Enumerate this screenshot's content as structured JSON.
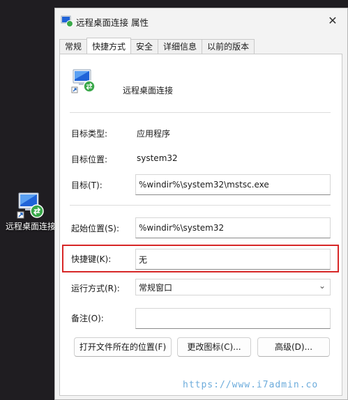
{
  "desktop": {
    "icon_label": "远程桌面连接"
  },
  "dialog": {
    "title": "远程桌面连接 属性",
    "close_glyph": "✕",
    "tabs": [
      "常规",
      "快捷方式",
      "安全",
      "详细信息",
      "以前的版本"
    ],
    "app_name": "远程桌面连接",
    "fields": {
      "target_type_label": "目标类型:",
      "target_type_value": "应用程序",
      "target_location_label": "目标位置:",
      "target_location_value": "system32",
      "target_label": "目标(T):",
      "target_value": "%windir%\\system32\\mstsc.exe",
      "start_in_label": "起始位置(S):",
      "start_in_value": "%windir%\\system32",
      "shortcut_key_label": "快捷键(K):",
      "shortcut_key_value": "无",
      "run_label": "运行方式(R):",
      "run_value": "常规窗口",
      "comment_label": "备注(O):",
      "comment_value": ""
    },
    "buttons": {
      "open_location": "打开文件所在的位置(F)",
      "change_icon": "更改图标(C)...",
      "advanced": "高级(D)..."
    }
  },
  "watermark": "https://www.i7admin.co",
  "colors": {
    "highlight": "#d72727",
    "dialog_bg": "#f3f3f3",
    "desktop_bg": "#1f1d21"
  }
}
